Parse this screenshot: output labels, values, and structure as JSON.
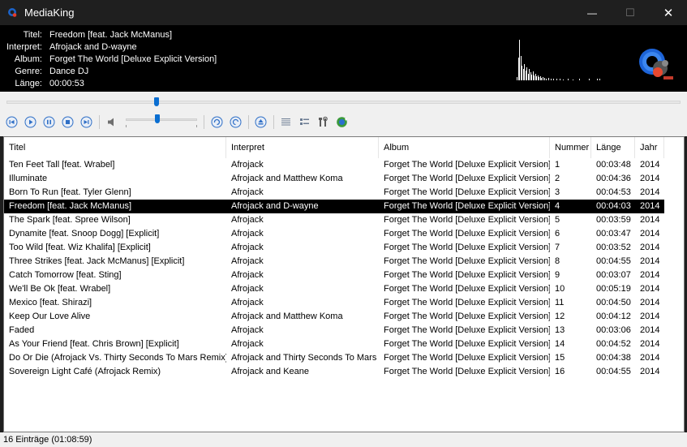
{
  "window": {
    "title": "MediaKing",
    "minimize_icon": "—",
    "maximize_icon": "☐",
    "close_icon": "✕"
  },
  "now_playing": {
    "title_label": "Titel:",
    "title": "Freedom [feat. Jack McManus]",
    "artist_label": "Interpret:",
    "artist": "Afrojack and D-wayne",
    "album_label": "Album:",
    "album": "Forget The World [Deluxe Explicit Version]",
    "genre_label": "Genre:",
    "genre": "Dance  DJ",
    "length_label": "Länge:",
    "length": "00:00:53"
  },
  "playback": {
    "seek_fraction": 0.223,
    "volume_fraction": 0.44
  },
  "columns": {
    "title": "Titel",
    "artist": "Interpret",
    "album": "Album",
    "number": "Nummer",
    "length": "Länge",
    "year": "Jahr"
  },
  "tracks": [
    {
      "title": "Ten Feet Tall [feat. Wrabel]",
      "artist": "Afrojack",
      "album": "Forget The World [Deluxe Explicit Version]",
      "number": "1",
      "length": "00:03:48",
      "year": "2014"
    },
    {
      "title": "Illuminate",
      "artist": "Afrojack and Matthew Koma",
      "album": "Forget The World [Deluxe Explicit Version]",
      "number": "2",
      "length": "00:04:36",
      "year": "2014"
    },
    {
      "title": "Born To Run [feat. Tyler Glenn]",
      "artist": "Afrojack",
      "album": "Forget The World [Deluxe Explicit Version]",
      "number": "3",
      "length": "00:04:53",
      "year": "2014"
    },
    {
      "title": "Freedom [feat. Jack McManus]",
      "artist": "Afrojack and D-wayne",
      "album": "Forget The World [Deluxe Explicit Version]",
      "number": "4",
      "length": "00:04:03",
      "year": "2014"
    },
    {
      "title": "The Spark [feat. Spree Wilson]",
      "artist": "Afrojack",
      "album": "Forget The World [Deluxe Explicit Version]",
      "number": "5",
      "length": "00:03:59",
      "year": "2014"
    },
    {
      "title": "Dynamite [feat. Snoop Dogg] [Explicit]",
      "artist": "Afrojack",
      "album": "Forget The World [Deluxe Explicit Version]",
      "number": "6",
      "length": "00:03:47",
      "year": "2014"
    },
    {
      "title": "Too Wild [feat. Wiz Khalifa] [Explicit]",
      "artist": "Afrojack",
      "album": "Forget The World [Deluxe Explicit Version]",
      "number": "7",
      "length": "00:03:52",
      "year": "2014"
    },
    {
      "title": "Three Strikes [feat. Jack McManus] [Explicit]",
      "artist": "Afrojack",
      "album": "Forget The World [Deluxe Explicit Version]",
      "number": "8",
      "length": "00:04:55",
      "year": "2014"
    },
    {
      "title": "Catch Tomorrow [feat. Sting]",
      "artist": "Afrojack",
      "album": "Forget The World [Deluxe Explicit Version]",
      "number": "9",
      "length": "00:03:07",
      "year": "2014"
    },
    {
      "title": "We'll Be Ok [feat. Wrabel]",
      "artist": "Afrojack",
      "album": "Forget The World [Deluxe Explicit Version]",
      "number": "10",
      "length": "00:05:19",
      "year": "2014"
    },
    {
      "title": "Mexico [feat. Shirazi]",
      "artist": "Afrojack",
      "album": "Forget The World [Deluxe Explicit Version]",
      "number": "11",
      "length": "00:04:50",
      "year": "2014"
    },
    {
      "title": "Keep Our Love Alive",
      "artist": "Afrojack and Matthew Koma",
      "album": "Forget The World [Deluxe Explicit Version]",
      "number": "12",
      "length": "00:04:12",
      "year": "2014"
    },
    {
      "title": "Faded",
      "artist": "Afrojack",
      "album": "Forget The World [Deluxe Explicit Version]",
      "number": "13",
      "length": "00:03:06",
      "year": "2014"
    },
    {
      "title": "As Your Friend [feat. Chris Brown] [Explicit]",
      "artist": "Afrojack",
      "album": "Forget The World [Deluxe Explicit Version]",
      "number": "14",
      "length": "00:04:52",
      "year": "2014"
    },
    {
      "title": "Do Or Die (Afrojack Vs. Thirty Seconds To Mars Remix)",
      "artist": "Afrojack and Thirty Seconds To Mars",
      "album": "Forget The World [Deluxe Explicit Version]",
      "number": "15",
      "length": "00:04:38",
      "year": "2014"
    },
    {
      "title": "Sovereign Light Café (Afrojack Remix)",
      "artist": "Afrojack and Keane",
      "album": "Forget The World [Deluxe Explicit Version]",
      "number": "16",
      "length": "00:04:55",
      "year": "2014"
    }
  ],
  "selected_track": "4",
  "status": {
    "text": "16 Einträge (01:08:59)"
  },
  "colors": {
    "accent": "#0a6ed1",
    "selection_bg": "#000000",
    "selection_fg": "#ffffff"
  }
}
